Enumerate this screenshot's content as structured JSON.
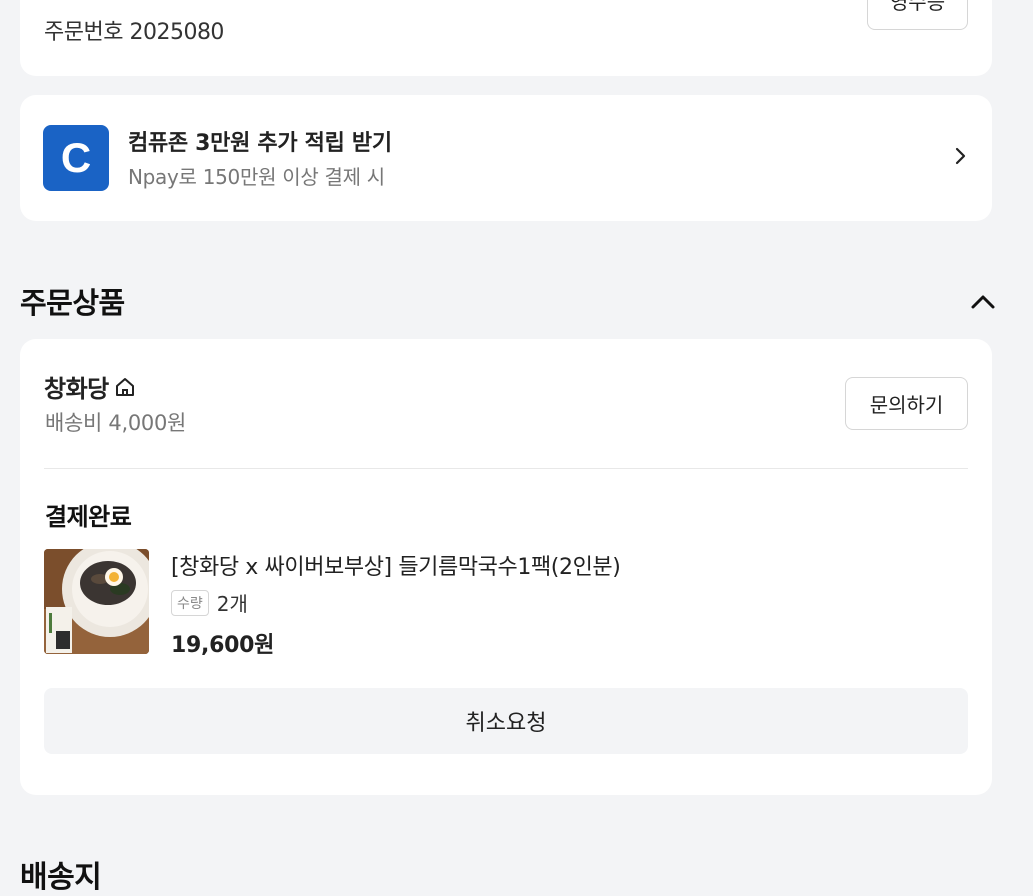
{
  "order_card": {
    "order_number": "주문번호 2025080",
    "top_button_label": "영수증"
  },
  "promo": {
    "logo_letter": "C",
    "title": "컴퓨존 3만원 추가 적립 받기",
    "subtitle": "Npay로 150만원 이상 결제 시",
    "icon": "chevron-right-icon",
    "logo_color": "#1a63c5"
  },
  "section": {
    "heading": "주문상품",
    "collapse_icon": "chevron-up-icon"
  },
  "product_card": {
    "store_name": "창화당",
    "store_icon": "home-icon",
    "shipping_fee": "배송비 4,000원",
    "inquiry_label": "문의하기",
    "status": "결제완료",
    "product_title": "[창화당 x 싸이버보부상] 들기름막국수1팩(2인분)",
    "qty_label": "수량",
    "qty_value": "2개",
    "price": "19,600원",
    "cancel_label": "취소요청"
  },
  "next_section": {
    "heading": "배송지"
  }
}
